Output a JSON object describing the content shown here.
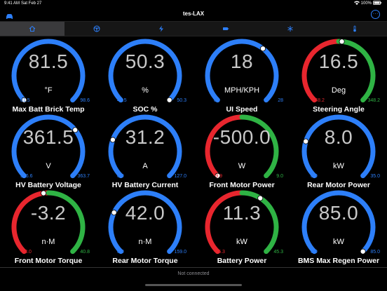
{
  "status": {
    "time": "9:41 AM",
    "date": "Sat Feb 27",
    "battery": "100%"
  },
  "header": {
    "title": "tes-LAX",
    "more_label": "···"
  },
  "tabs": [
    {
      "name": "home-icon",
      "active": true
    },
    {
      "name": "wheel-icon",
      "active": false
    },
    {
      "name": "bolt-icon",
      "active": false
    },
    {
      "name": "battery-icon",
      "active": false
    },
    {
      "name": "temperature-fan-icon",
      "active": false
    },
    {
      "name": "thermometer-icon",
      "active": false
    }
  ],
  "colors": {
    "blue": "#2d7ff9",
    "red": "#e8262e",
    "green": "#2fb344",
    "accent": "#2d7ff9"
  },
  "gauges": [
    {
      "label": "Max Batt Brick Temp",
      "value": "81.5",
      "unit": "°F",
      "min": "81.5",
      "max": "98.6",
      "type": "blue",
      "pos": 0.0
    },
    {
      "label": "SOC %",
      "value": "50.3",
      "unit": "%",
      "min": "47.5",
      "max": "50.3",
      "type": "blue",
      "pos": 1.0
    },
    {
      "label": "UI Speed",
      "value": "18",
      "unit": "MPH/KPH",
      "min": "0",
      "max": "28",
      "type": "blue",
      "pos": 0.64
    },
    {
      "label": "Steering Angle",
      "value": "16.5",
      "unit": "Deg",
      "min": "-348.2",
      "max": "348.2",
      "type": "redgreen",
      "pos": 0.52
    },
    {
      "label": "HV Battery Voltage",
      "value": "361.5",
      "unit": "V",
      "min": "356.6",
      "max": "363.7",
      "type": "blue",
      "pos": 0.69
    },
    {
      "label": "HV Battery Current",
      "value": "31.2",
      "unit": "A",
      "min": "0.9",
      "max": "127.0",
      "type": "blue",
      "pos": 0.24
    },
    {
      "label": "Front Motor Power",
      "value": "-500.0",
      "unit": "W",
      "min": "-9.9",
      "max": "9.0",
      "type": "redgreen",
      "pos": 0.0
    },
    {
      "label": "Rear Motor Power",
      "value": "8.0",
      "unit": "kW",
      "min": "0.0",
      "max": "35.0",
      "type": "blue",
      "pos": 0.23
    },
    {
      "label": "Front Motor Torque",
      "value": "-3.2",
      "unit": "n·M",
      "min": "-48.0",
      "max": "40.8",
      "type": "redgreen",
      "pos": 0.47
    },
    {
      "label": "Rear Motor Torque",
      "value": "42.0",
      "unit": "n·M",
      "min": "0.0",
      "max": "159.0",
      "type": "blue",
      "pos": 0.26
    },
    {
      "label": "Battery Power",
      "value": "11.3",
      "unit": "kW",
      "min": "-45.3",
      "max": "45.3",
      "type": "redgreen",
      "pos": 0.62
    },
    {
      "label": "BMS Max Regen Power",
      "value": "85.0",
      "unit": "kW",
      "min": "0.0",
      "max": "85.0",
      "type": "blue",
      "pos": 1.0
    }
  ],
  "footer": {
    "connection_status": "Not connected"
  }
}
